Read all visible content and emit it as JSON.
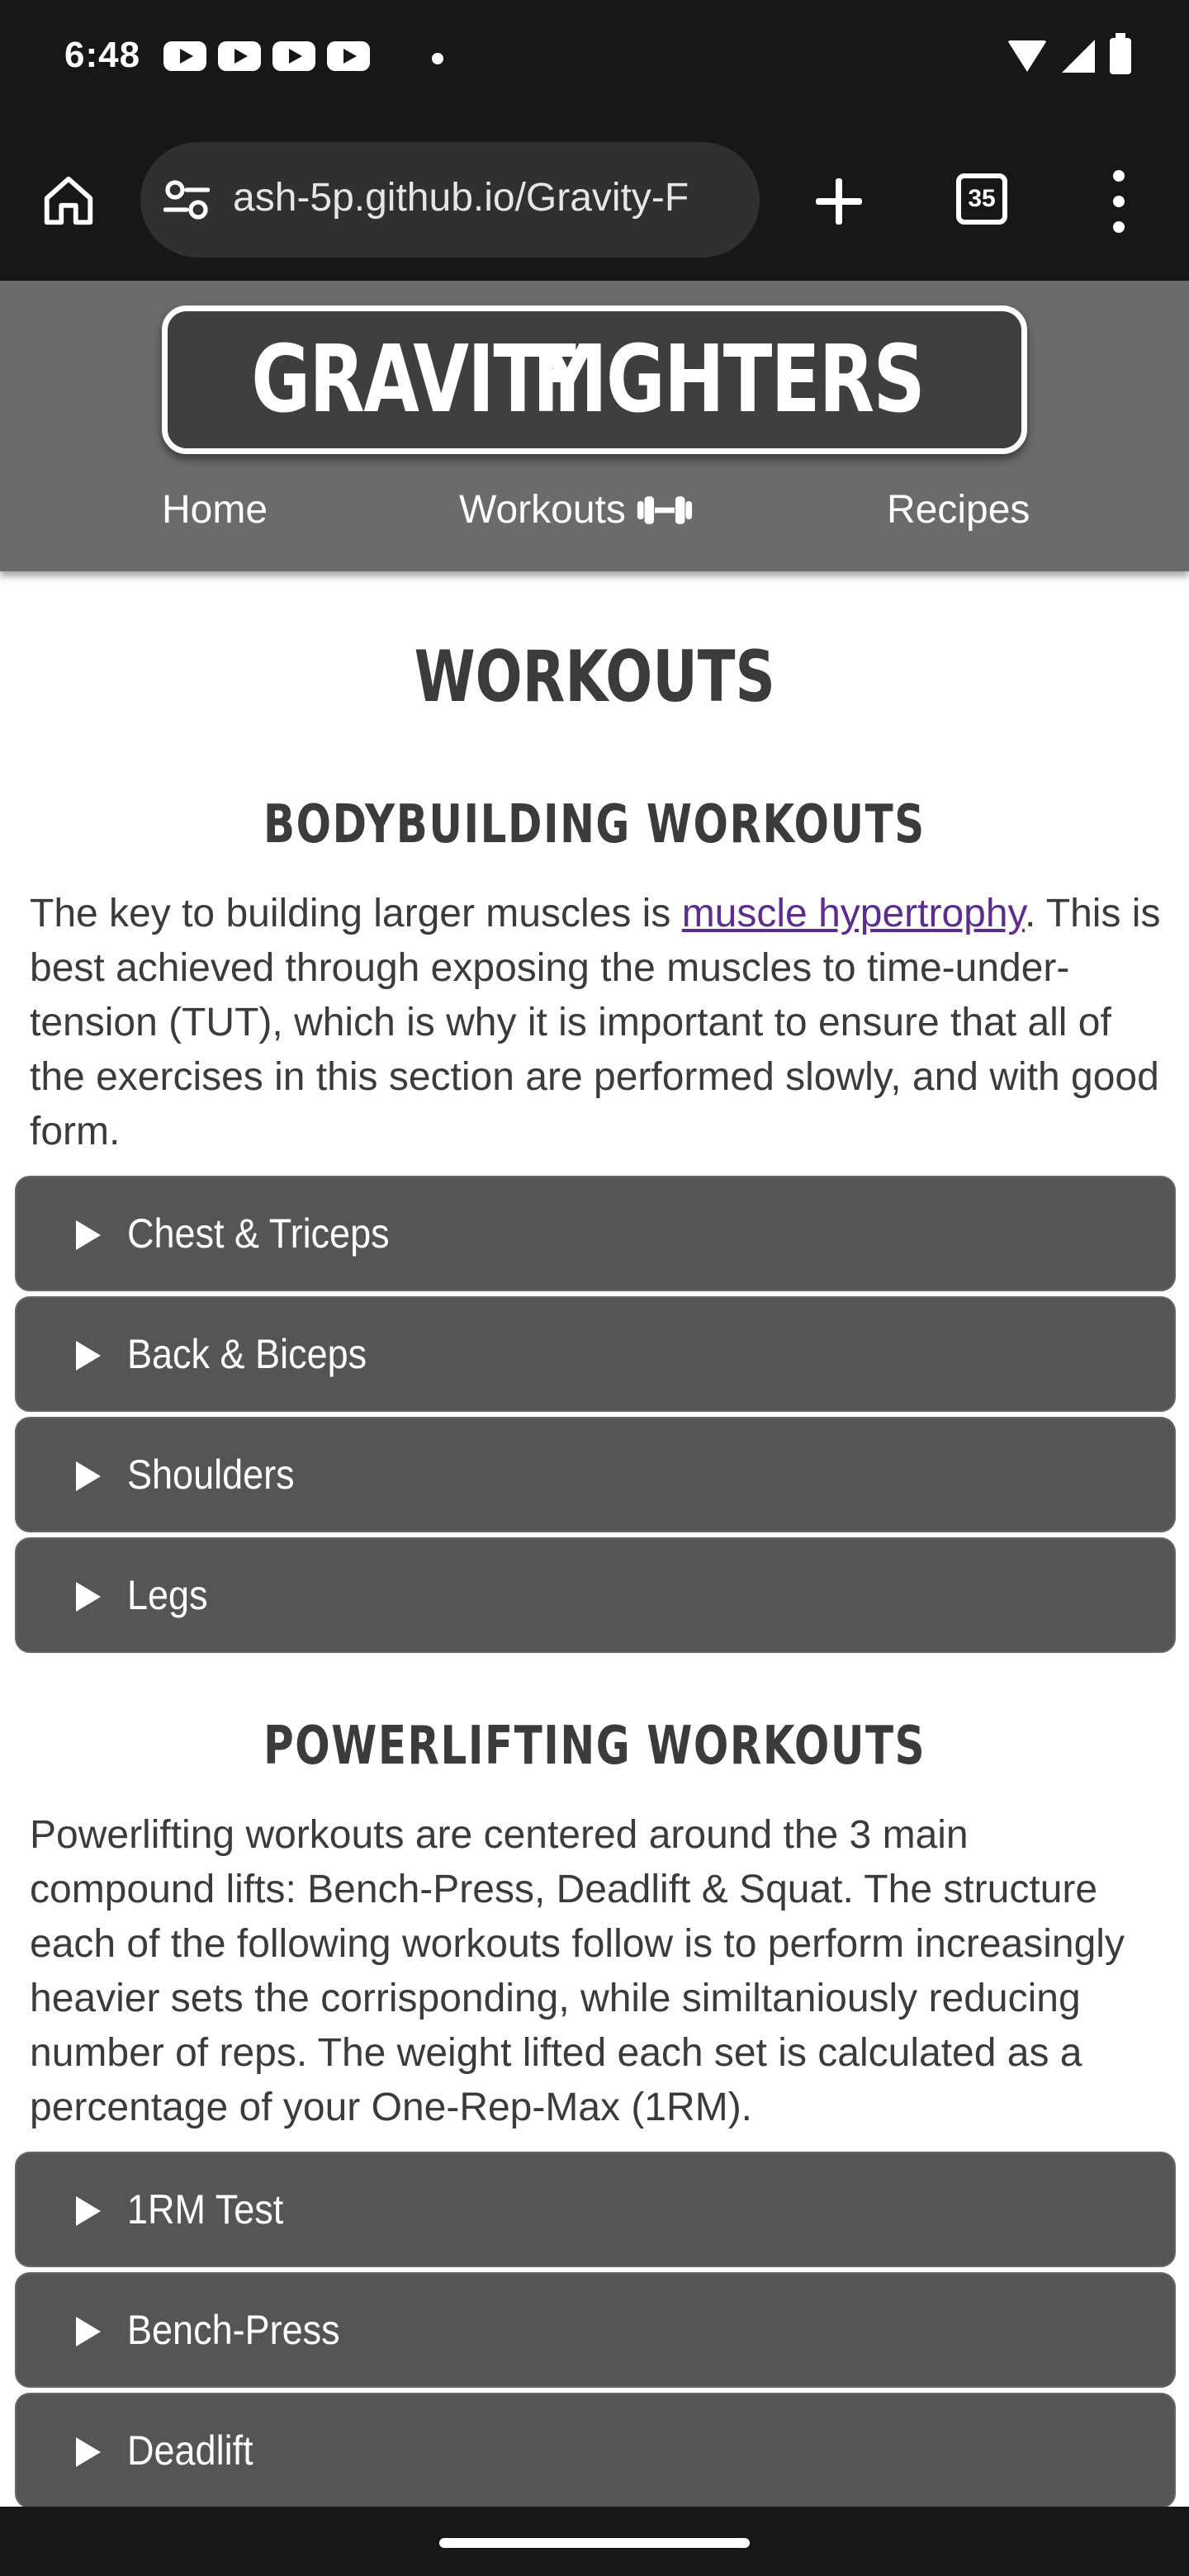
{
  "status_bar": {
    "time": "6:48"
  },
  "browser": {
    "url": "ash-5p.github.io/Gravity-F",
    "tab_count": "35"
  },
  "site": {
    "logo_left": "GRAVITY",
    "logo_right": "FIGHTERS",
    "nav": {
      "home": "Home",
      "workouts": "Workouts",
      "recipes": "Recipes"
    }
  },
  "page": {
    "title": "WORKOUTS",
    "bodybuilding": {
      "heading": "BODYBUILDING WORKOUTS",
      "text_before_link": "The key to building larger muscles is ",
      "link_text": "muscle hypertrophy",
      "text_after_link": ". This is best achieved through exposing the muscles to time-under-tension (TUT), which is why it is important to ensure that all of the exercises in this section are performed slowly, and with good form.",
      "items": [
        "Chest & Triceps",
        "Back & Biceps",
        "Shoulders",
        "Legs"
      ]
    },
    "powerlifting": {
      "heading": "POWERLIFTING WORKOUTS",
      "text": "Powerlifting workouts are centered around the 3 main compound lifts: Bench-Press, Deadlift & Squat. The structure each of the following workouts follow is to perform increasingly heavier sets the corrisponding, while similtaniously reducing number of reps. The weight lifted each set is calculated as a percentage of your One-Rep-Max (1RM).",
      "items": [
        "1RM Test",
        "Bench-Press",
        "Deadlift"
      ]
    }
  },
  "colors": {
    "header_bg": "#6b6b6b",
    "accordion_bg": "#555555",
    "link": "#5b2d8e",
    "text": "#3b3b3b"
  },
  "icons": [
    "home-icon",
    "site-settings-icon",
    "new-tab-icon",
    "tab-switcher-icon",
    "more-menu-icon",
    "dumbbell-icon",
    "expand-triangle-icon"
  ]
}
